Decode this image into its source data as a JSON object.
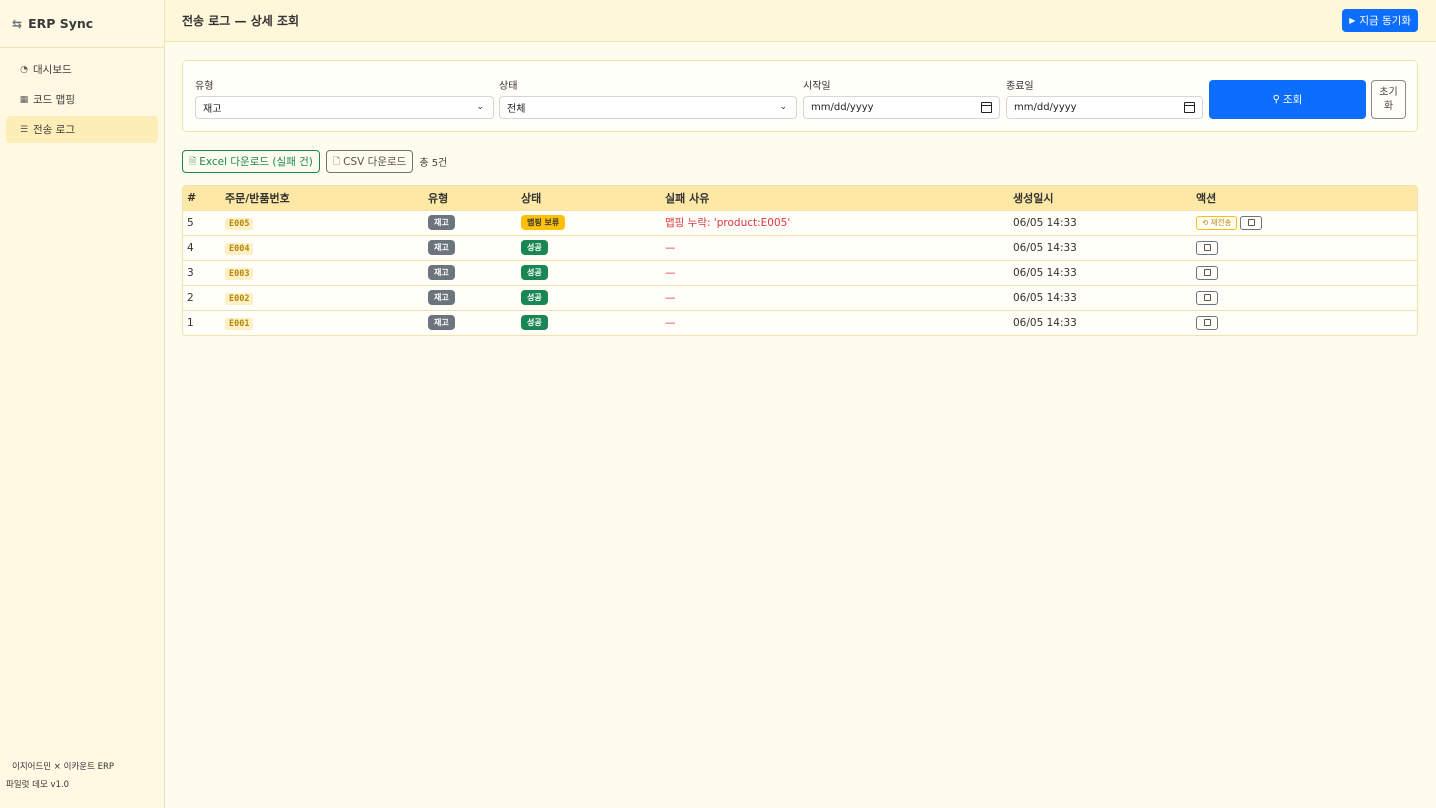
{
  "app": {
    "brand": "ERP Sync",
    "brand_icon": "arrows-swap-icon"
  },
  "sidebar": {
    "items": [
      {
        "label": "대시보드",
        "icon": "speedometer-icon",
        "active": false
      },
      {
        "label": "코드 맵핑",
        "icon": "table-icon",
        "active": false
      },
      {
        "label": "전송 로그",
        "icon": "list-icon",
        "active": true
      }
    ],
    "footer_line1": "이지어드민 × 이카운트 ERP",
    "footer_line2": "파일럿 데모 v1.0"
  },
  "header": {
    "title": "전송 로그 — 상세 조회",
    "sync_label": "지금 동기화"
  },
  "filters": {
    "type_label": "유형",
    "type_value": "재고",
    "status_label": "상태",
    "status_value": "전체",
    "start_label": "시작일",
    "start_placeholder": "mm/dd/yyyy",
    "end_label": "종료일",
    "end_placeholder": "mm/dd/yyyy",
    "search_label": "조회",
    "reset_label": "초기화"
  },
  "toolbar": {
    "excel_label": "Excel 다운로드 (실패 건)",
    "csv_label": "CSV 다운로드",
    "total": "총 5건"
  },
  "table": {
    "headers": [
      "#",
      "주문/반품번호",
      "유형",
      "상태",
      "실패 사유",
      "생성일시",
      "액션"
    ],
    "rows": [
      {
        "num": "5",
        "code": "E005",
        "type": "재고",
        "status": "맵핑 보류",
        "status_kind": "warn",
        "reason": "맵핑 누락: 'product:E005'",
        "created": "06/05 14:33",
        "retry": "재전송"
      },
      {
        "num": "4",
        "code": "E004",
        "type": "재고",
        "status": "성공",
        "status_kind": "ok",
        "reason": "—",
        "created": "06/05 14:33",
        "retry": ""
      },
      {
        "num": "3",
        "code": "E003",
        "type": "재고",
        "status": "성공",
        "status_kind": "ok",
        "reason": "—",
        "created": "06/05 14:33",
        "retry": ""
      },
      {
        "num": "2",
        "code": "E002",
        "type": "재고",
        "status": "성공",
        "status_kind": "ok",
        "reason": "—",
        "created": "06/05 14:33",
        "retry": ""
      },
      {
        "num": "1",
        "code": "E001",
        "type": "재고",
        "status": "성공",
        "status_kind": "ok",
        "reason": "—",
        "created": "06/05 14:33",
        "retry": ""
      }
    ]
  },
  "colors": {
    "primary": "#0d6efd",
    "success": "#198754",
    "warning": "#ffc107",
    "danger": "#dc3545"
  }
}
